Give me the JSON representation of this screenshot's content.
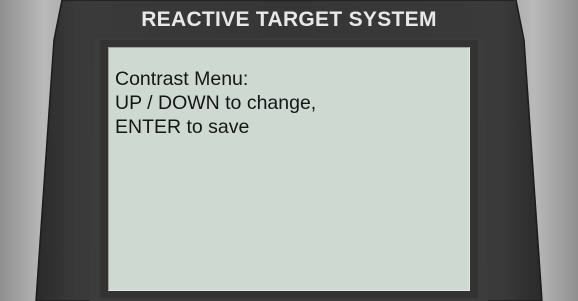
{
  "device": {
    "title": "REACTIVE TARGET SYSTEM"
  },
  "screen": {
    "lines": [
      "Contrast Menu:",
      "UP / DOWN to change,",
      "ENTER to save"
    ]
  }
}
